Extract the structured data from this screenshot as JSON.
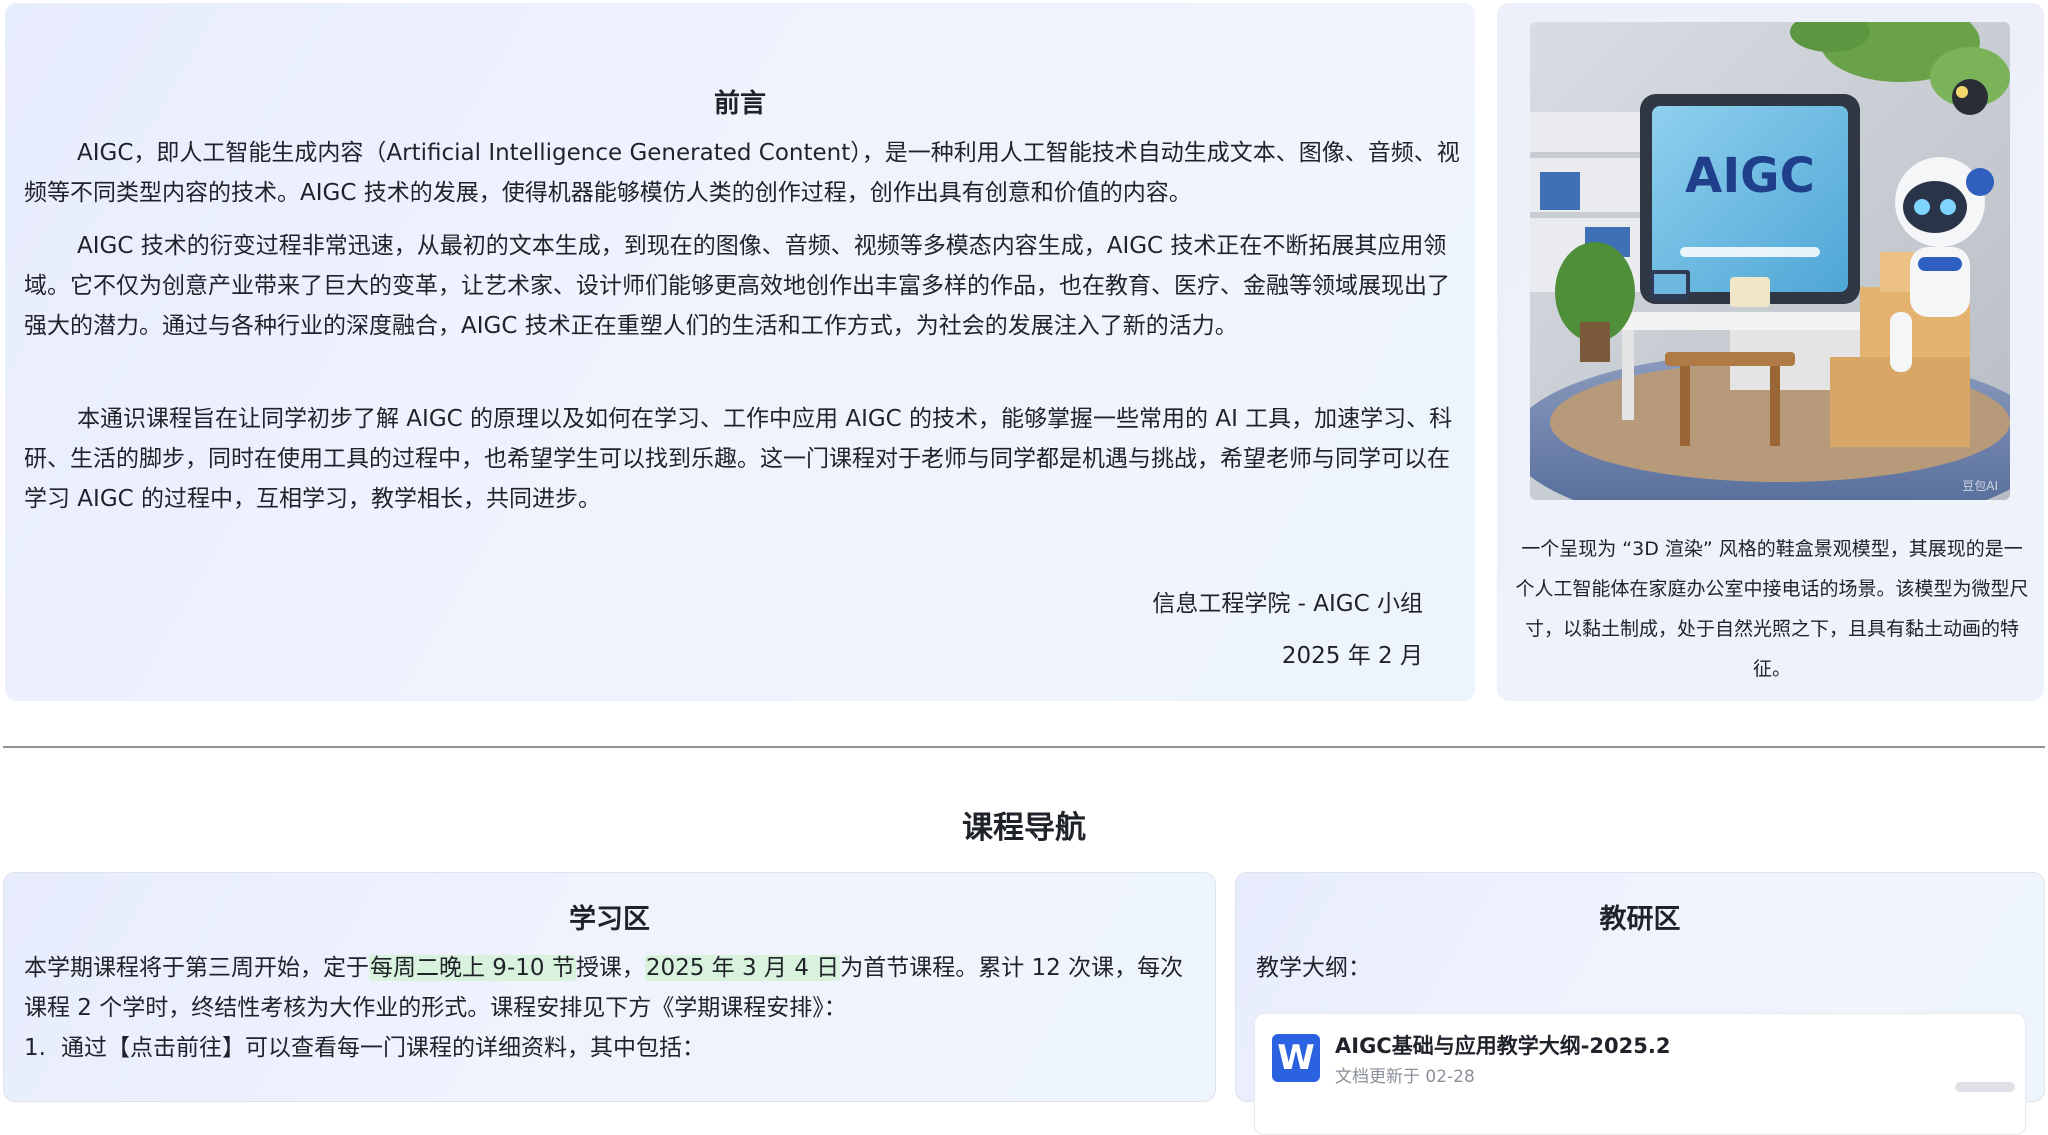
{
  "preface": {
    "title": "前言",
    "paragraphs": [
      "AIGC，即人工智能生成内容（Artificial Intelligence Generated Content），是一种利用人工智能技术自动生成文本、图像、音频、视频等不同类型内容的技术。AIGC 技术的发展，使得机器能够模仿人类的创作过程，创作出具有创意和价值的内容。",
      "AIGC 技术的衍变过程非常迅速，从最初的文本生成，到现在的图像、音频、视频等多模态内容生成，AIGC 技术正在不断拓展其应用领域。它不仅为创意产业带来了巨大的变革，让艺术家、设计师们能够更高效地创作出丰富多样的作品，也在教育、医疗、金融等领域展现出了强大的潜力。通过与各种行业的深度融合，AIGC 技术正在重塑人们的生活和工作方式，为社会的发展注入了新的活力。",
      "本通识课程旨在让同学初步了解 AIGC 的原理以及如何在学习、工作中应用 AIGC 的技术，能够掌握一些常用的 AI 工具，加速学习、科研、生活的脚步，同时在使用工具的过程中，也希望学生可以找到乐趣。这一门课程对于老师与同学都是机遇与挑战，希望老师与同学可以在学习 AIGC 的过程中，互相学习，教学相长，共同进步。"
    ],
    "signature_org": "信息工程学院 - AIGC 小组",
    "signature_date": "2025 年 2 月"
  },
  "illustration": {
    "screen_text": "AIGC",
    "watermark": "豆包AI",
    "caption": "一个呈现为 “3D 渲染” 风格的鞋盒景观模型，其展现的是一个人工智能体在家庭办公室中接电话的场景。该模型为微型尺寸，以黏土制成，处于自然光照之下，且具有黏土动画的特征。"
  },
  "course_nav": {
    "title": "课程导航",
    "study": {
      "title": "学习区",
      "intro_before": "本学期课程将于第三周开始，定于",
      "highlight_time": "每周二晚上 9-10 节",
      "intro_mid": "授课，",
      "highlight_date": "2025 年 3 月 4 日",
      "intro_after": "为首节课程。累计 12 次课，每次课程 2 个学时，终结性考核为大作业的形式。课程安排见下方《学期课程安排》：",
      "list_num": "1.",
      "list_item_1": "通过【点击前往】可以查看每一门课程的详细资料，其中包括："
    },
    "research": {
      "title": "教研区",
      "outline_label": "教学大纲：",
      "doc_icon": "W",
      "doc_name": "AIGC基础与应用教学大纲-2025.2",
      "doc_updated": "文档更新于 02-28"
    }
  }
}
